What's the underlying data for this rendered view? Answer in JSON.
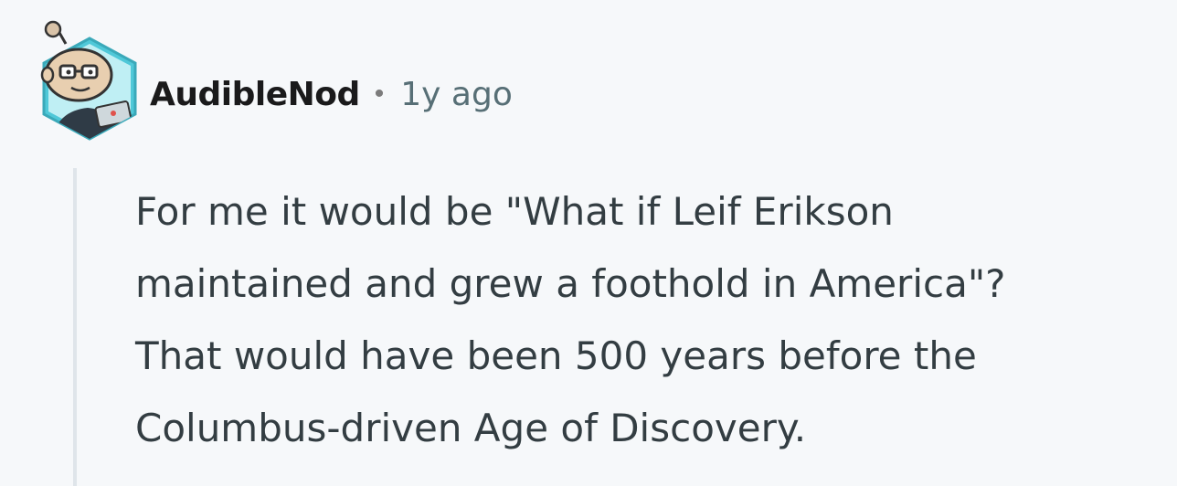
{
  "comment": {
    "author": "AudibleNod",
    "separator": "•",
    "timestamp": "1y ago",
    "avatar_icon": "snoo-avatar-icon",
    "body_lines": [
      "For me it would be \"What if Leif Erikson",
      "maintained and grew a foothold in America\"?",
      "That would have been 500 years before the",
      "Columbus-driven Age of Discovery."
    ]
  },
  "colors": {
    "background": "#f6f8fa",
    "author": "#1a1a1b",
    "timestamp": "#576f76",
    "body": "#333d42",
    "thread_line": "#dfe5ea",
    "avatar_ring": "#4fc8d8"
  }
}
